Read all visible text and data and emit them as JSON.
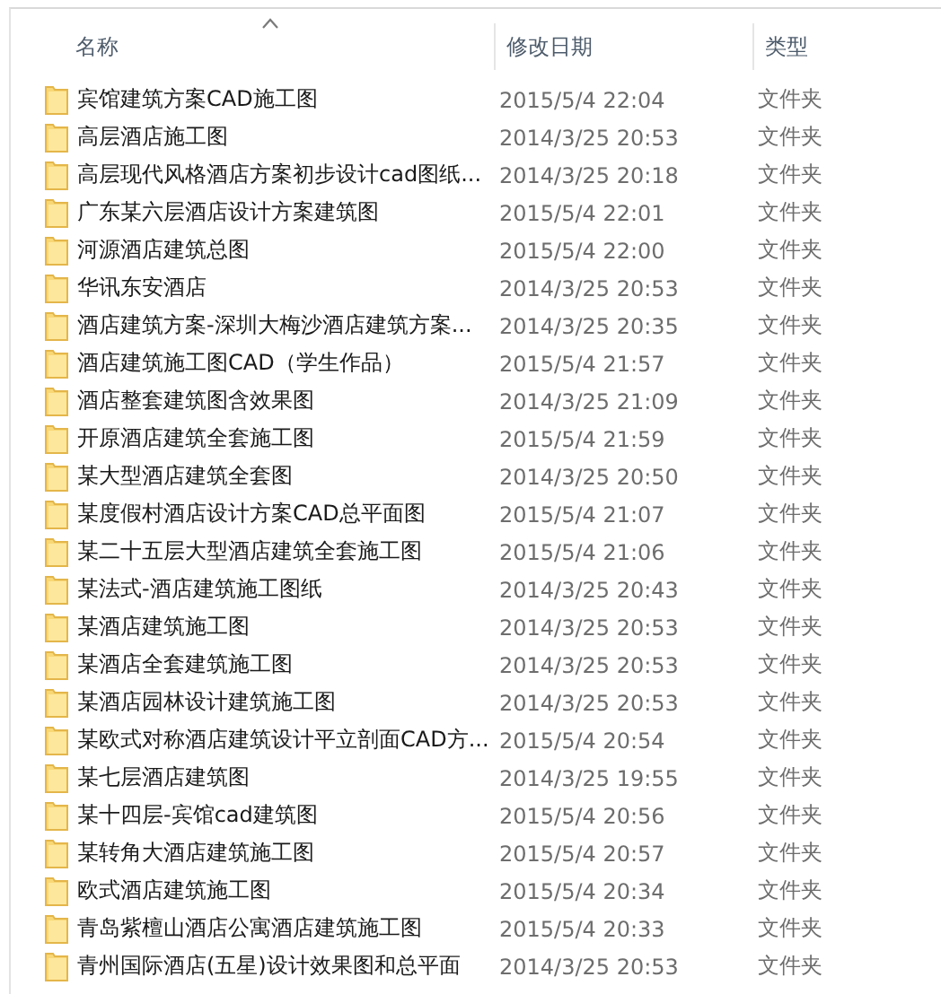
{
  "columns": [
    {
      "label": "名称",
      "sorted": true
    },
    {
      "label": "修改日期",
      "sorted": false
    },
    {
      "label": "类型",
      "sorted": false
    }
  ],
  "rows": [
    {
      "name": "宾馆建筑方案CAD施工图",
      "date": "2015/5/4 22:04",
      "type": "文件夹"
    },
    {
      "name": "高层酒店施工图",
      "date": "2014/3/25 20:53",
      "type": "文件夹"
    },
    {
      "name": "高层现代风格酒店方案初步设计cad图纸...",
      "date": "2014/3/25 20:18",
      "type": "文件夹"
    },
    {
      "name": "广东某六层酒店设计方案建筑图",
      "date": "2015/5/4 22:01",
      "type": "文件夹"
    },
    {
      "name": "河源酒店建筑总图",
      "date": "2015/5/4 22:00",
      "type": "文件夹"
    },
    {
      "name": "华讯东安酒店",
      "date": "2014/3/25 20:53",
      "type": "文件夹"
    },
    {
      "name": "酒店建筑方案-深圳大梅沙酒店建筑方案...",
      "date": "2014/3/25 20:35",
      "type": "文件夹"
    },
    {
      "name": "酒店建筑施工图CAD（学生作品）",
      "date": "2015/5/4 21:57",
      "type": "文件夹"
    },
    {
      "name": "酒店整套建筑图含效果图",
      "date": "2014/3/25 21:09",
      "type": "文件夹"
    },
    {
      "name": "开原酒店建筑全套施工图",
      "date": "2015/5/4 21:59",
      "type": "文件夹"
    },
    {
      "name": "某大型酒店建筑全套图",
      "date": "2014/3/25 20:50",
      "type": "文件夹"
    },
    {
      "name": "某度假村酒店设计方案CAD总平面图",
      "date": "2015/5/4 21:07",
      "type": "文件夹"
    },
    {
      "name": "某二十五层大型酒店建筑全套施工图",
      "date": "2015/5/4 21:06",
      "type": "文件夹"
    },
    {
      "name": "某法式-酒店建筑施工图纸",
      "date": "2014/3/25 20:43",
      "type": "文件夹"
    },
    {
      "name": "某酒店建筑施工图",
      "date": "2014/3/25 20:53",
      "type": "文件夹"
    },
    {
      "name": "某酒店全套建筑施工图",
      "date": "2014/3/25 20:53",
      "type": "文件夹"
    },
    {
      "name": "某酒店园林设计建筑施工图",
      "date": "2014/3/25 20:53",
      "type": "文件夹"
    },
    {
      "name": "某欧式对称酒店建筑设计平立剖面CAD方...",
      "date": "2015/5/4 20:54",
      "type": "文件夹"
    },
    {
      "name": "某七层酒店建筑图",
      "date": "2014/3/25 19:55",
      "type": "文件夹"
    },
    {
      "name": "某十四层-宾馆cad建筑图",
      "date": "2015/5/4 20:56",
      "type": "文件夹"
    },
    {
      "name": "某转角大酒店建筑施工图",
      "date": "2015/5/4 20:57",
      "type": "文件夹"
    },
    {
      "name": "欧式酒店建筑施工图",
      "date": "2015/5/4 20:34",
      "type": "文件夹"
    },
    {
      "name": "青岛紫檀山酒店公寓酒店建筑施工图",
      "date": "2015/5/4 20:33",
      "type": "文件夹"
    },
    {
      "name": "青州国际酒店(五星)设计效果图和总平面",
      "date": "2014/3/25 20:53",
      "type": "文件夹"
    }
  ]
}
